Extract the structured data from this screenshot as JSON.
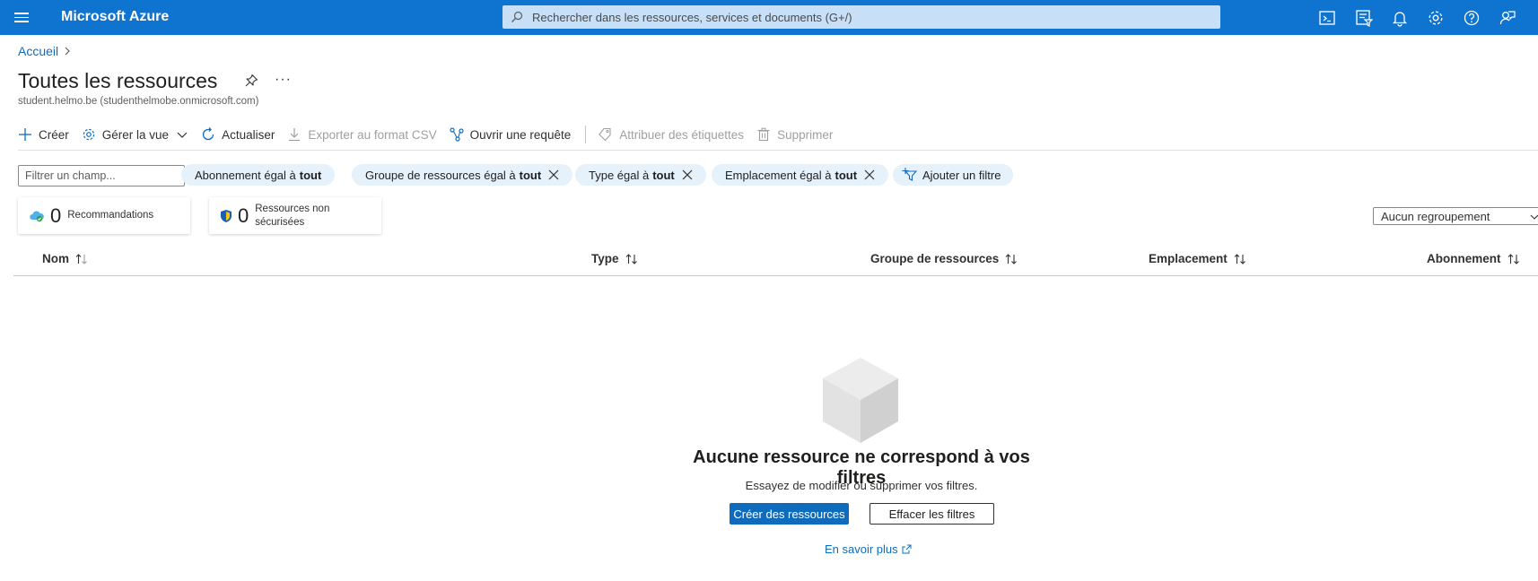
{
  "header": {
    "brand": "Microsoft Azure",
    "search_placeholder": "Rechercher dans les ressources, services et documents (G+/)"
  },
  "breadcrumb": {
    "home": "Accueil"
  },
  "page": {
    "title": "Toutes les ressources",
    "subtitle": "student.helmo.be (studenthelmobe.onmicrosoft.com)"
  },
  "toolbar": {
    "create": "Créer",
    "manage_view": "Gérer la vue",
    "refresh": "Actualiser",
    "export_csv": "Exporter au format CSV",
    "open_query": "Ouvrir une requête",
    "assign_tags": "Attribuer des étiquettes",
    "delete": "Supprimer"
  },
  "filters": {
    "field_placeholder": "Filtrer un champ...",
    "pills": [
      {
        "label": "Abonnement égal à",
        "value": "tout"
      },
      {
        "label": "Groupe de ressources égal à",
        "value": "tout"
      },
      {
        "label": "Type égal à",
        "value": "tout"
      },
      {
        "label": "Emplacement égal à",
        "value": "tout"
      }
    ],
    "add_filter": "Ajouter un filtre"
  },
  "summary": {
    "recommendations": {
      "count": "0",
      "label": "Recommandations"
    },
    "unsecured": {
      "count": "0",
      "label": "Ressources non sécurisées"
    }
  },
  "grouping": {
    "selected": "Aucun regroupement"
  },
  "table": {
    "columns": [
      "Nom",
      "Type",
      "Groupe de ressources",
      "Emplacement",
      "Abonnement"
    ]
  },
  "empty_state": {
    "title": "Aucune ressource ne correspond à vos filtres",
    "description": "Essayez de modifier ou supprimer vos filtres.",
    "create_button": "Créer des ressources",
    "clear_button": "Effacer les filtres",
    "learn_more": "En savoir plus"
  },
  "colors": {
    "accent": "#0f6cbd",
    "topbar": "#0f74d0",
    "pill": "#e5f1fb"
  }
}
